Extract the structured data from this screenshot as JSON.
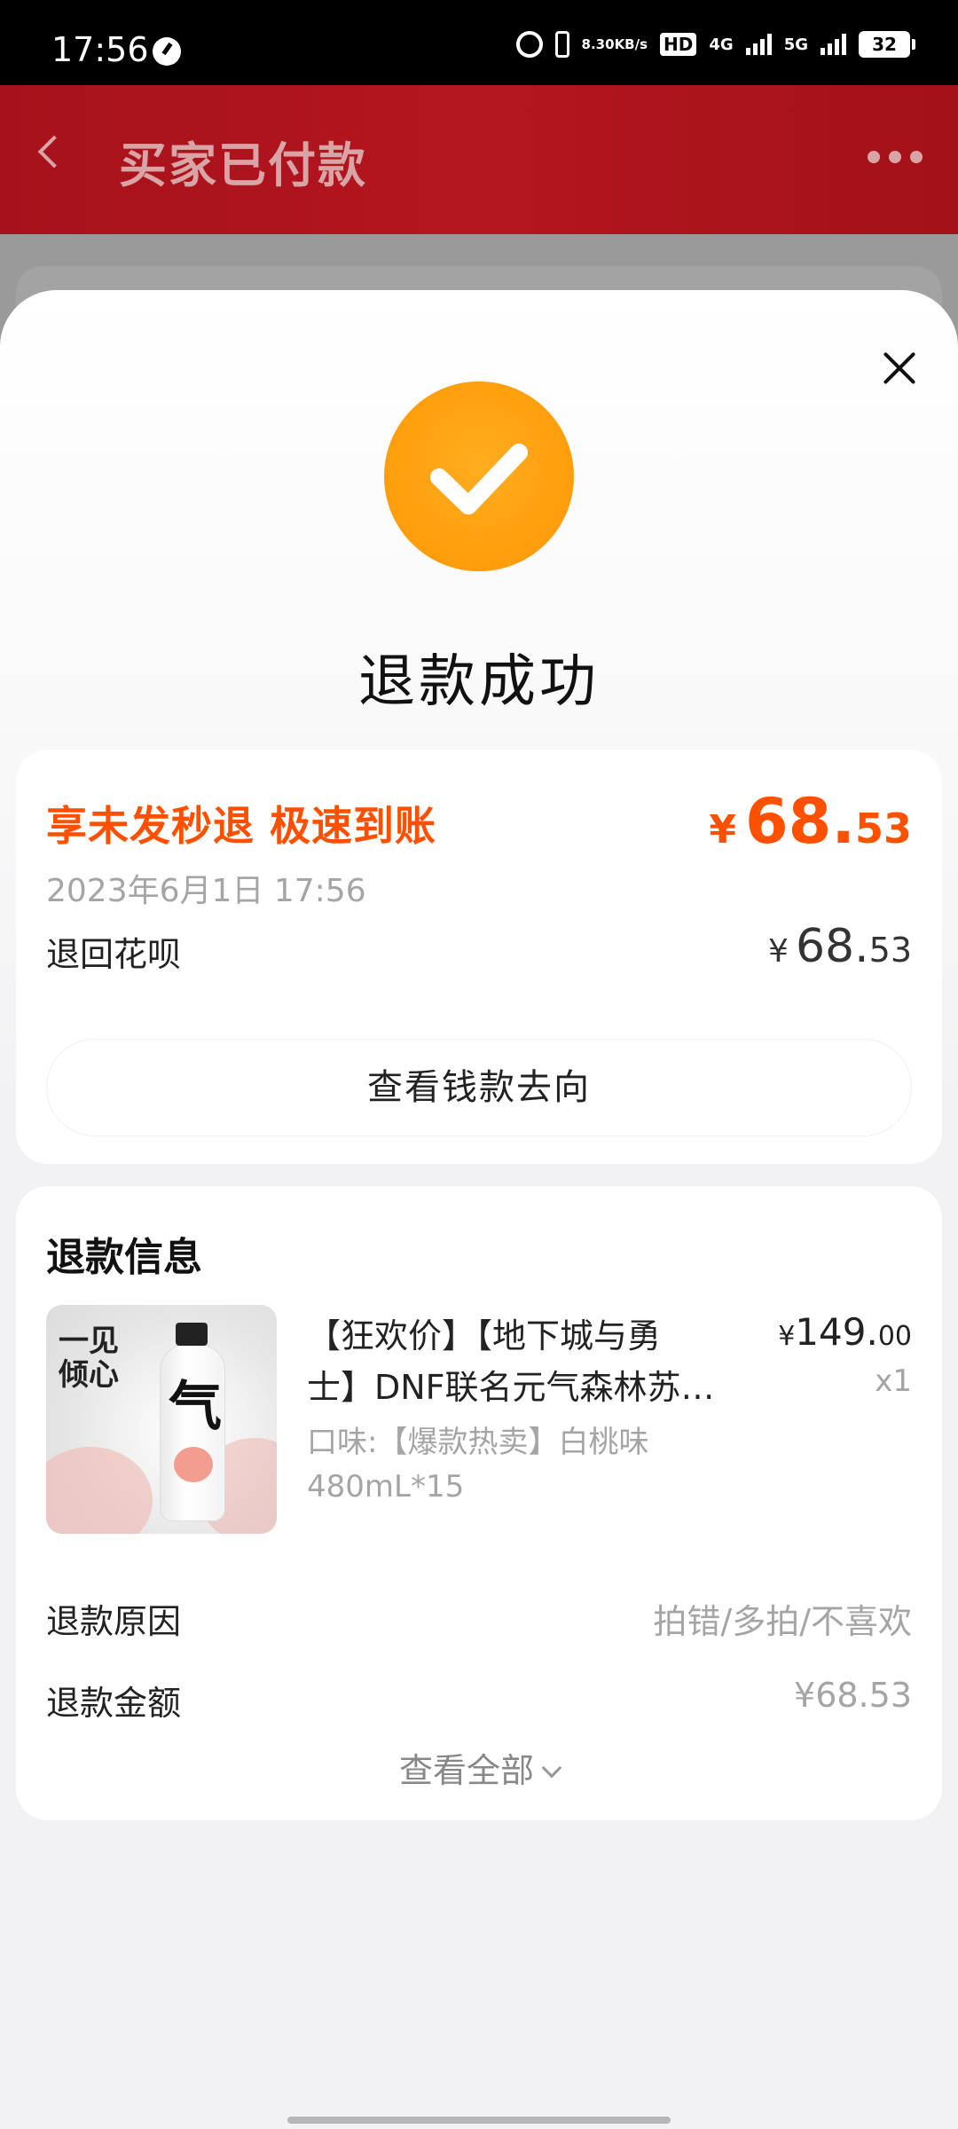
{
  "status_bar": {
    "time": "17:56",
    "speed_value": "8.30",
    "speed_unit": "KB/s",
    "hd_label": "HD",
    "net1": "4G",
    "net2": "5G",
    "battery": "32"
  },
  "header": {
    "title": "买家已付款"
  },
  "sheet": {
    "title": "退款成功",
    "status_color": "#ff9d0b"
  },
  "refund": {
    "promo": "享未发秒退 极速到账",
    "amount_currency": "¥",
    "amount_int": "68.",
    "amount_dec": "53",
    "date": "2023年6月1日 17:56",
    "destination_label": "退回花呗",
    "destination_currency": "¥",
    "destination_int": "68.",
    "destination_dec": "53",
    "trace_button": "查看钱款去向",
    "accent": "#ff5000"
  },
  "info": {
    "title": "退款信息",
    "product": {
      "image_slogan_line1": "一见",
      "image_slogan_line2": "倾心",
      "image_bottle_char": "气",
      "name_line1": "【狂欢价】【地下城与勇",
      "name_line2": "士】DNF联名元气森林苏…",
      "spec": "口味:【爆款热卖】白桃味 480mL*15",
      "price_currency": "¥",
      "price_int": "149.",
      "price_dec": "00",
      "quantity": "x1"
    },
    "reason_label": "退款原因",
    "reason_value": "拍错/多拍/不喜欢",
    "amount_label": "退款金额",
    "amount_value": "¥68.53",
    "view_all": "查看全部"
  }
}
